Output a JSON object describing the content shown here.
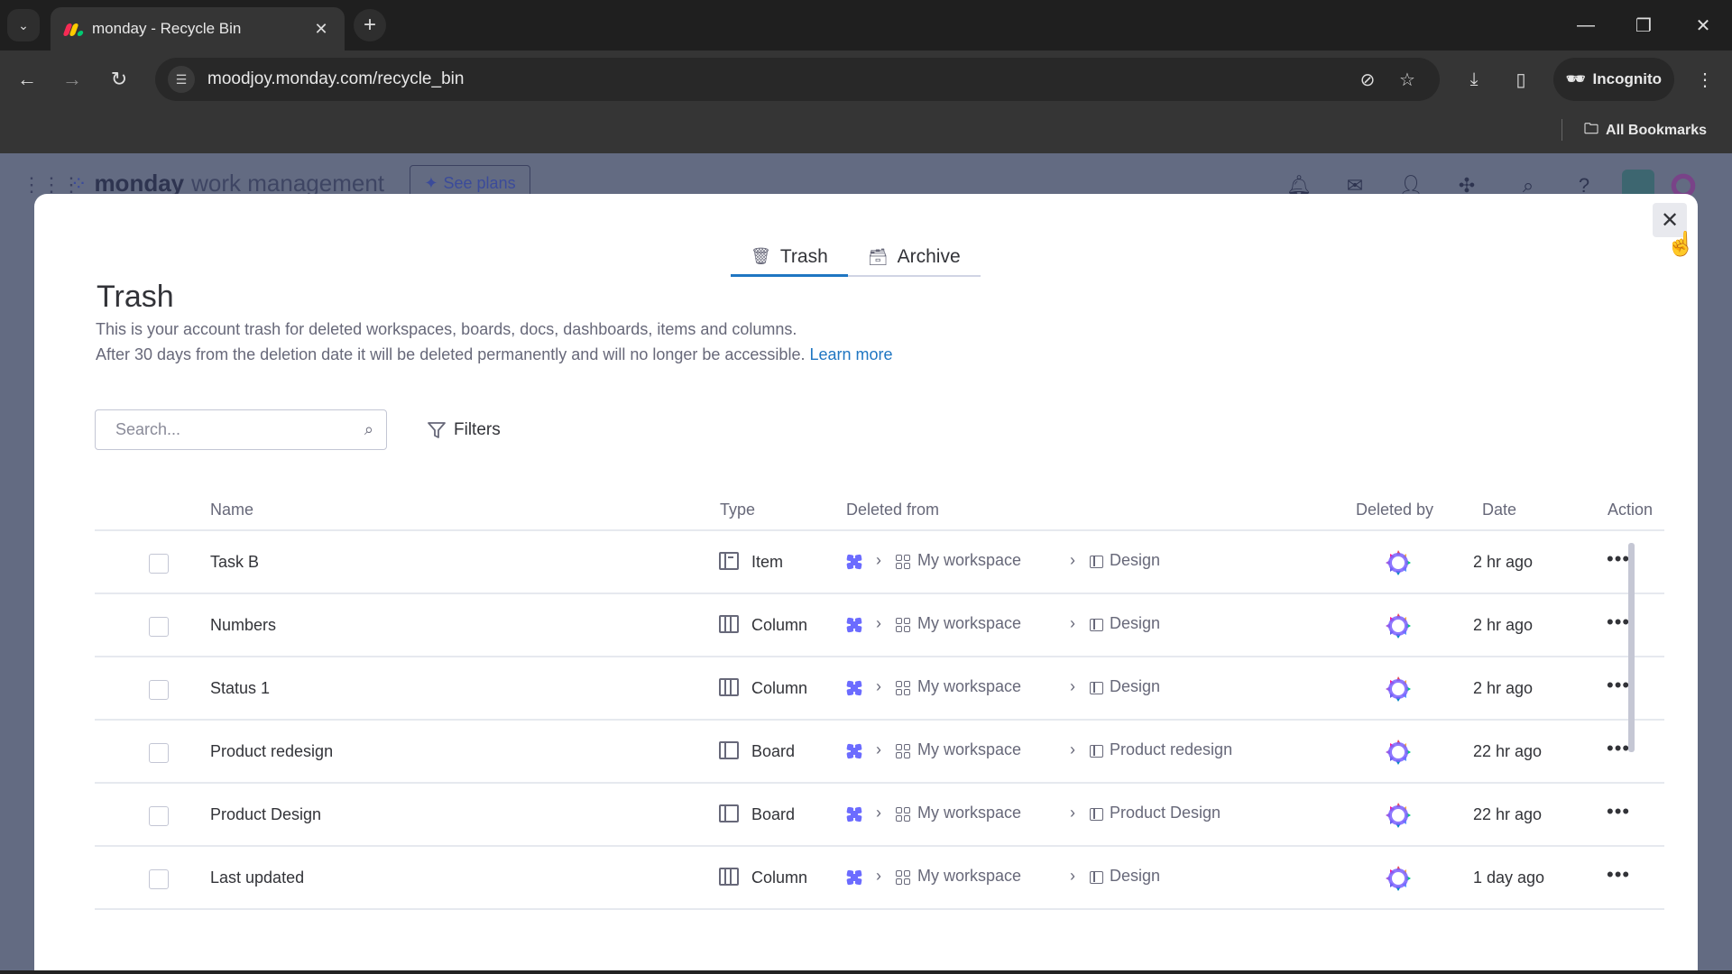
{
  "browser": {
    "tab_title": "monday - Recycle Bin",
    "url": "moodjoy.monday.com/recycle_bin",
    "incognito_label": "Incognito",
    "bookmarks_label": "All Bookmarks",
    "icons": [
      "tab-list-icon",
      "close-tab-icon",
      "new-tab-icon",
      "minimize-icon",
      "restore-icon",
      "close-window-icon",
      "back-icon",
      "forward-icon",
      "reload-icon",
      "site-info-icon",
      "eye-off-icon",
      "star-icon",
      "download-icon",
      "side-panel-icon",
      "incognito-icon",
      "menu-icon",
      "folder-icon"
    ]
  },
  "app": {
    "brand_bold": "monday",
    "brand_light": "work management",
    "see_plans_label": "See plans",
    "icons": [
      "apps-grid-icon",
      "bell-icon",
      "inbox-icon",
      "invite-icon",
      "puzzle-icon",
      "search-icon",
      "help-icon"
    ]
  },
  "modal": {
    "tabs": [
      {
        "label": "Trash",
        "icon": "trash-icon",
        "active": true
      },
      {
        "label": "Archive",
        "icon": "archive-icon",
        "active": false
      }
    ],
    "title": "Trash",
    "description_line1": "This is your account trash for deleted workspaces, boards, docs, dashboards, items and columns.",
    "description_line2": "After 30 days from the deletion date it will be deleted permanently and will no longer be accessible.",
    "learn_more": "Learn more",
    "search_placeholder": "Search...",
    "filters_label": "Filters",
    "columns": {
      "name": "Name",
      "type": "Type",
      "deleted_from": "Deleted from",
      "deleted_by": "Deleted by",
      "date": "Date",
      "action": "Action"
    },
    "rows": [
      {
        "name": "Task B",
        "type": "Item",
        "type_icon": "item",
        "workspace": "My workspace",
        "board": "Design",
        "date": "2 hr ago"
      },
      {
        "name": "Numbers",
        "type": "Column",
        "type_icon": "column",
        "workspace": "My workspace",
        "board": "Design",
        "date": "2 hr ago"
      },
      {
        "name": "Status 1",
        "type": "Column",
        "type_icon": "column",
        "workspace": "My workspace",
        "board": "Design",
        "date": "2 hr ago"
      },
      {
        "name": "Product redesign",
        "type": "Board",
        "type_icon": "board",
        "workspace": "My workspace",
        "board": "Product redesign",
        "date": "22 hr ago"
      },
      {
        "name": "Product Design",
        "type": "Board",
        "type_icon": "board",
        "workspace": "My workspace",
        "board": "Product Design",
        "date": "22 hr ago"
      },
      {
        "name": "Last updated",
        "type": "Column",
        "type_icon": "column",
        "workspace": "My workspace",
        "board": "Design",
        "date": "1 day ago"
      }
    ],
    "more_label": "•••",
    "crumb_sep": "›"
  },
  "colors": {
    "accent": "#1f76c2",
    "text_primary": "#323338",
    "text_secondary": "#676879",
    "workspace_icon": "#6c6cff",
    "overlay": "#636b82"
  }
}
